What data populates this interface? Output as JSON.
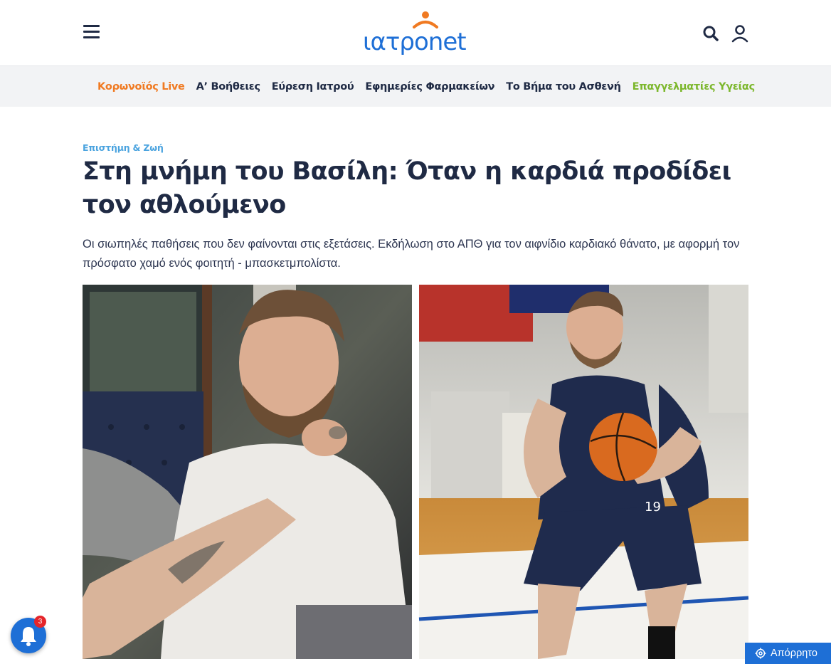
{
  "header": {
    "logo_text": "ιατρonet",
    "menu_icon": "hamburger-icon",
    "search_icon": "search-icon",
    "user_icon": "user-icon"
  },
  "nav": {
    "items": [
      {
        "label": "Κορωνοϊός Live",
        "color": "#f07a22"
      },
      {
        "label": "Α’ Βοήθειες",
        "color": "#1f2a44"
      },
      {
        "label": "Εύρεση Ιατρού",
        "color": "#1f2a44"
      },
      {
        "label": "Εφημερίες Φαρμακείων",
        "color": "#1f2a44"
      },
      {
        "label": "Το Βήμα του Ασθενή",
        "color": "#1f2a44"
      },
      {
        "label": "Επαγγελματίες Υγείας",
        "color": "#7cb72c"
      }
    ]
  },
  "article": {
    "category": "Επιστήμη & Ζωή",
    "title": "Στη μνήμη του Βασίλη: Όταν η καρδιά προδίδει τον αθλούμενο",
    "lede": "Οι σιωπηλές παθήσεις που δεν φαίνονται στις εξετάσεις. Εκδήλωση στο ΑΠΘ για τον αιφνίδιο καρδιακό θάνατο, με αφορμή τον πρόσφατο χαμό ενός φοιτητή - μπασκετμπολίστα.",
    "jersey_number": "19"
  },
  "notifications": {
    "count": "3",
    "icon": "bell-icon"
  },
  "privacy": {
    "label": "Απόρρητο",
    "icon": "gear-icon"
  },
  "colors": {
    "brand_blue": "#1e6fd6",
    "brand_orange": "#f07a22",
    "brand_green": "#7cb72c",
    "category_blue": "#4aa3df",
    "text_dark": "#1f2a44"
  }
}
